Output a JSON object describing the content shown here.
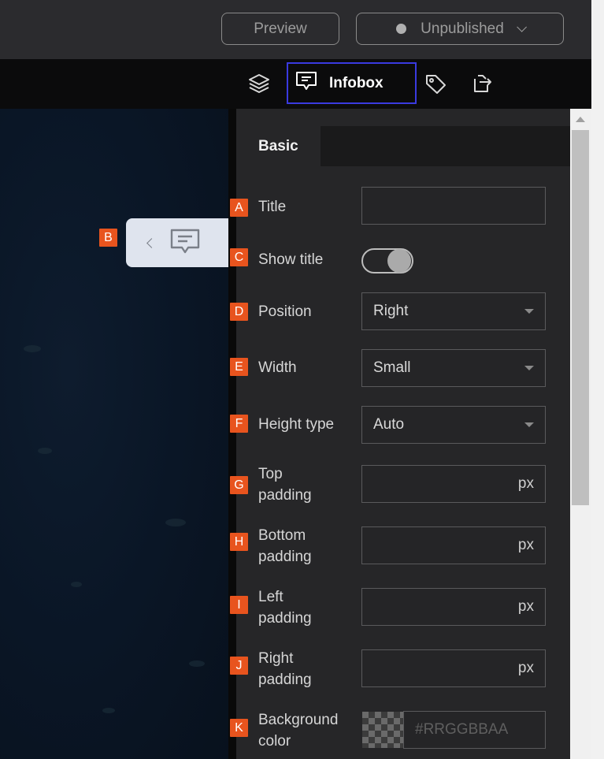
{
  "header": {
    "preview_label": "Preview",
    "publish_status": "Unpublished"
  },
  "toolbar": {
    "icons": [
      "layers-icon",
      "infobox-icon",
      "tag-icon",
      "export-icon"
    ],
    "active_tab_label": "Infobox",
    "active_border_color": "#3a3ae0"
  },
  "panel": {
    "tabs": [
      "Basic"
    ],
    "fields": {
      "title": {
        "label": "Title",
        "value": ""
      },
      "show_title": {
        "label": "Show title",
        "on": true
      },
      "position": {
        "label": "Position",
        "value": "Right"
      },
      "width": {
        "label": "Width",
        "value": "Small"
      },
      "height_type": {
        "label": "Height type",
        "value": "Auto"
      },
      "top_padding": {
        "label1": "Top",
        "label2": "padding",
        "unit": "px"
      },
      "bottom_padding": {
        "label1": "Bottom",
        "label2": "padding",
        "unit": "px"
      },
      "left_padding": {
        "label1": "Left",
        "label2": "padding",
        "unit": "px"
      },
      "right_padding": {
        "label1": "Right",
        "label2": "padding",
        "unit": "px"
      },
      "background_color": {
        "label1": "Background",
        "label2": "color",
        "placeholder": "#RRGGBBAA"
      }
    }
  },
  "markers": {
    "a": "A",
    "b": "B",
    "c": "C",
    "d": "D",
    "e": "E",
    "f": "F",
    "g": "G",
    "h": "H",
    "i": "I",
    "j": "J",
    "k": "K",
    "color": "#e8541e"
  }
}
